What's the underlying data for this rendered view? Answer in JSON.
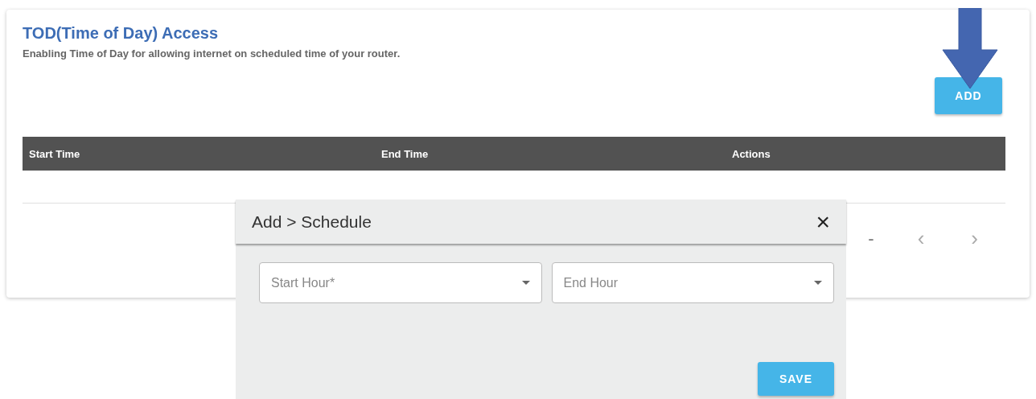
{
  "card": {
    "title": "TOD(Time of Day) Access",
    "description": "Enabling Time of Day for allowing internet on scheduled time of your router.",
    "add_button": "ADD"
  },
  "table": {
    "columns": [
      "Start Time",
      "End Time",
      "Actions"
    ]
  },
  "pagination": {
    "range": "-",
    "prev": "‹",
    "next": "›"
  },
  "dialog": {
    "title": "Add > Schedule",
    "close": "×",
    "fields": [
      {
        "placeholder": "Start Hour*"
      },
      {
        "placeholder": "End Hour"
      }
    ],
    "save_button": "SAVE"
  }
}
